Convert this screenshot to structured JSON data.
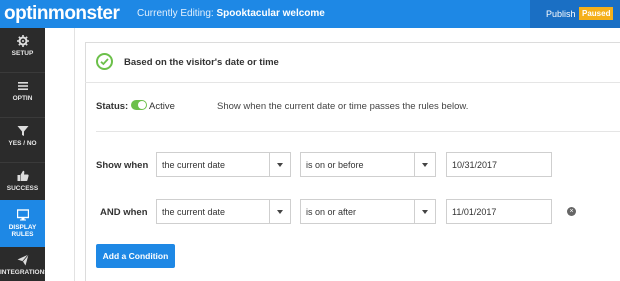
{
  "topbar": {
    "logo": "optinmonster",
    "editing_prefix": "Currently Editing:",
    "campaign_name": "Spooktacular welcome",
    "publish_label": "Publish",
    "status_badge": "Paused"
  },
  "sidebar": {
    "items": [
      {
        "label": "SETUP",
        "icon": "gear-icon"
      },
      {
        "label": "OPTIN",
        "icon": "menu-icon"
      },
      {
        "label": "YES / NO",
        "icon": "filter-icon"
      },
      {
        "label": "SUCCESS",
        "icon": "thumbs-up-icon"
      },
      {
        "label": "DISPLAY RULES",
        "icon": "monitor-icon"
      },
      {
        "label": "INTEGRATIONS",
        "icon": "paper-plane-icon"
      }
    ]
  },
  "rule": {
    "title": "Based on the visitor's date or time",
    "status_label": "Status:",
    "status_value": "Active",
    "description": "Show when the current date or time passes the rules below."
  },
  "conditions": [
    {
      "label": "Show when",
      "subject": "the current date",
      "operator": "is on or before",
      "value": "10/31/2017"
    },
    {
      "label": "AND when",
      "subject": "the current date",
      "operator": "is on or after",
      "value": "11/01/2017"
    }
  ],
  "add_condition_label": "Add a Condition",
  "colors": {
    "accent": "#1e88e5",
    "sidebar": "#2b2b2b",
    "active_green": "#6cc04a",
    "badge": "#f5b01a"
  }
}
